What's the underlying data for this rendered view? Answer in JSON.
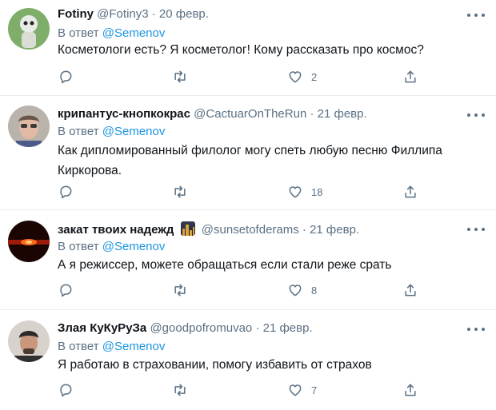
{
  "tweets": [
    {
      "name": "Fotiny",
      "handle": "@Fotiny3",
      "date": "· 20 февр.",
      "reply_prefix": "В ответ",
      "reply_to": "@Semenov",
      "text": "Косметологи есть? Я косметолог! Кому рассказать про космос?",
      "likes": "2"
    },
    {
      "name": "крипантус-кнопкокрас",
      "handle": "@CactuarOnTheRun",
      "date": "· 21 февр.",
      "reply_prefix": "В ответ",
      "reply_to": "@Semenov",
      "text": "Как дипломированный филолог могу спеть любую песню Филлипа Киркорова.",
      "likes": "18"
    },
    {
      "name": "закат твоих надежд",
      "handle": "@sunsetofderams",
      "date": "· 21 февр.",
      "reply_prefix": "В ответ",
      "reply_to": "@Semenov",
      "text": "А я режиссер, можете обращаться если стали реже срать",
      "likes": "8"
    },
    {
      "name": "Злая КуКуРуЗа",
      "handle": "@goodpofromuvao",
      "date": "· 21 февр.",
      "reply_prefix": "В ответ",
      "reply_to": "@Semenov",
      "text": "Я работаю в страховании, помогу избавить от страхов",
      "likes": "7"
    }
  ],
  "colors": {
    "text": "#0f1419",
    "secondary": "#5b7083",
    "link": "#1b95e0",
    "divider": "#e6ecf0"
  },
  "icons": [
    "reply-icon",
    "retweet-icon",
    "like-icon",
    "share-icon",
    "more-icon"
  ]
}
